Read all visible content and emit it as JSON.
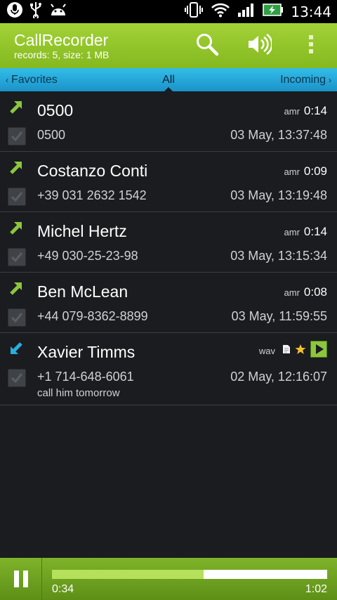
{
  "status_bar": {
    "time": "13:44",
    "icons": [
      "microphone-icon",
      "usb-icon",
      "android-icon",
      "vibrate-icon",
      "wifi-icon",
      "signal-icon",
      "battery-charging-icon"
    ]
  },
  "app": {
    "title": "CallRecorder",
    "subtitle": "records: 5, size: 1 MB",
    "accent": "#8cc63f",
    "actions": [
      "search-icon",
      "speaker-icon",
      "overflow-menu-icon"
    ]
  },
  "tabs": {
    "left": "Favorites",
    "center": "All",
    "right": "Incoming",
    "color": "#2aaee0"
  },
  "recordings": [
    {
      "direction": "outgoing",
      "name": "0500",
      "number": "0500",
      "format": "amr",
      "duration": "0:14",
      "date": "03 May, 13:37:48",
      "note": ""
    },
    {
      "direction": "outgoing",
      "name": "Costanzo Conti",
      "number": "+39 031 2632 1542",
      "format": "amr",
      "duration": "0:09",
      "date": "03 May, 13:19:48",
      "note": ""
    },
    {
      "direction": "outgoing",
      "name": "Michel Hertz",
      "number": "+49 030-25-23-98",
      "format": "amr",
      "duration": "0:14",
      "date": "03 May, 13:15:34",
      "note": ""
    },
    {
      "direction": "outgoing",
      "name": "Ben McLean",
      "number": "+44 079-8362-8899",
      "format": "amr",
      "duration": "0:08",
      "date": "03 May, 11:59:55",
      "note": ""
    },
    {
      "direction": "incoming",
      "name": "Xavier Timms",
      "number": "+1 714-648-6061",
      "format": "wav",
      "duration": "",
      "date": "02 May, 12:16:07",
      "note": "call him tomorrow",
      "icons": [
        "note-icon",
        "star-icon",
        "play-icon"
      ]
    }
  ],
  "player": {
    "elapsed": "0:34",
    "total": "1:02",
    "progress": 0.55
  }
}
